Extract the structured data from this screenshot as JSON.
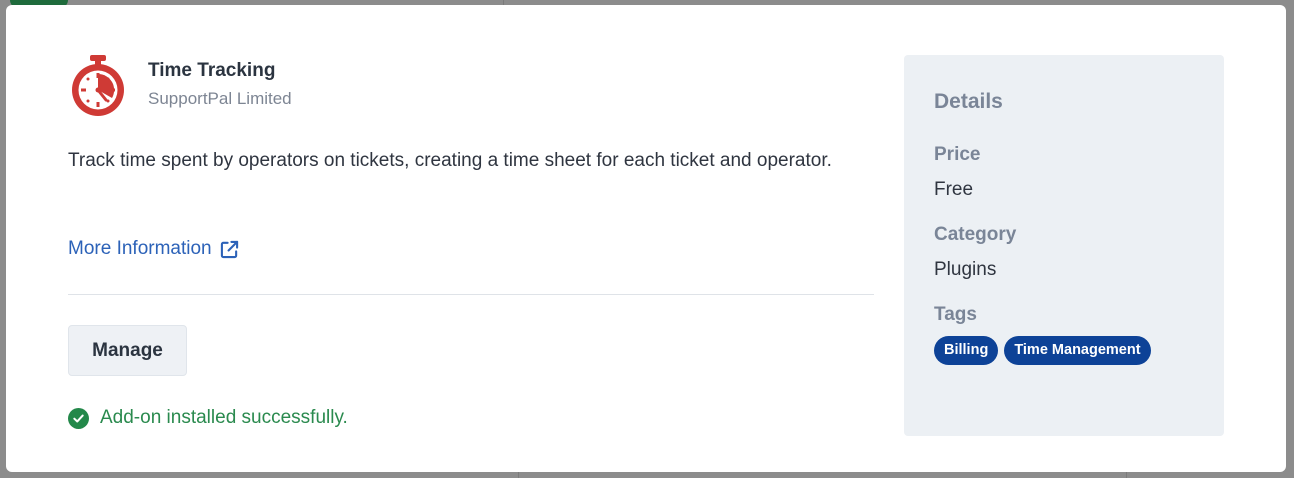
{
  "addon": {
    "name": "Time Tracking",
    "vendor": "SupportPal Limited",
    "description": "Track time spent by operators on tickets, creating a time sheet for each ticket and operator.",
    "more_info_label": "More Information",
    "manage_label": "Manage",
    "success_message": "Add-on installed successfully."
  },
  "details": {
    "title": "Details",
    "price_label": "Price",
    "price_value": "Free",
    "category_label": "Category",
    "category_value": "Plugins",
    "tags_label": "Tags",
    "tags": [
      "Billing",
      "Time Management"
    ]
  },
  "icons": {
    "logo": "stopwatch-icon",
    "external_link": "external-link-icon",
    "success": "check-circle-icon"
  },
  "colors": {
    "logo_red": "#cf3a35",
    "link_blue": "#2c62b8",
    "tag_blue": "#0d4297",
    "success_green": "#2a8a4e",
    "details_bg": "#ecf0f4"
  }
}
